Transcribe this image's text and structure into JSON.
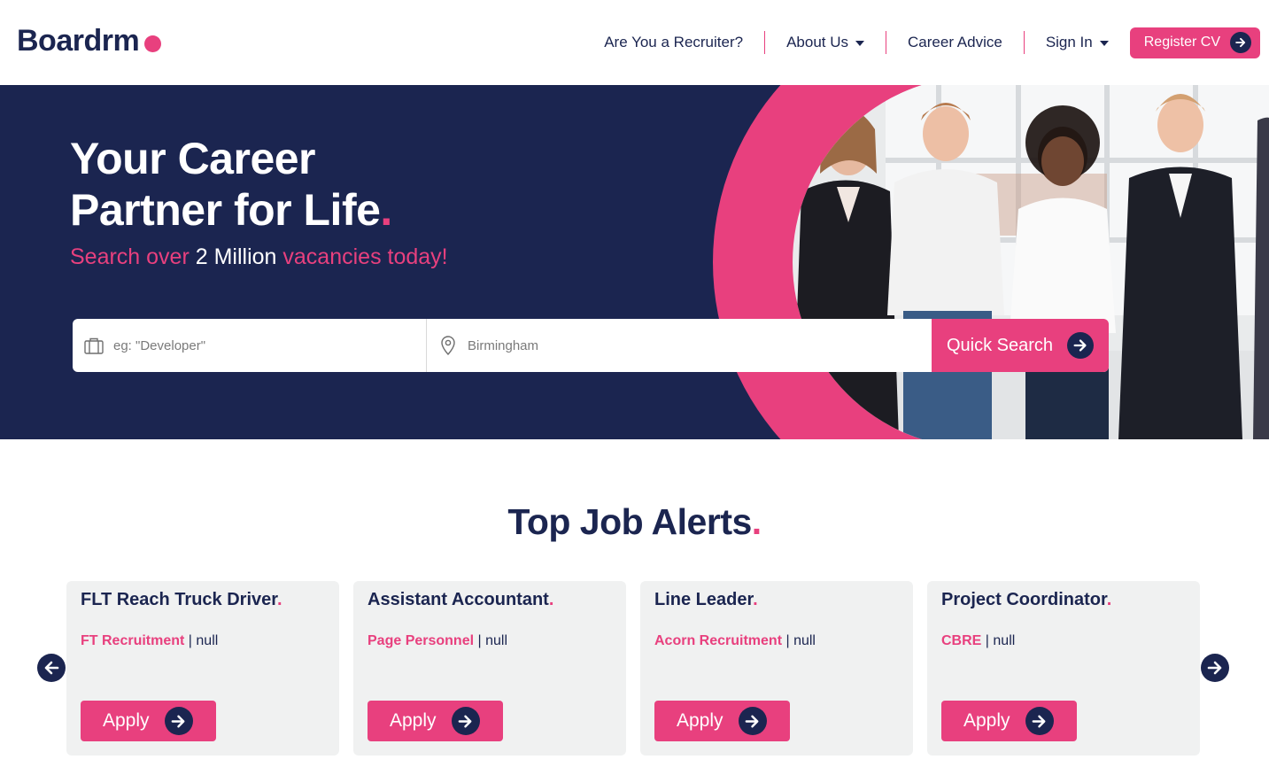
{
  "brand": {
    "name": "Boardrm",
    "pink": "#e8407e",
    "navy": "#1b2550"
  },
  "nav": {
    "items": [
      {
        "label": "Are You a Recruiter?"
      },
      {
        "label": "About Us"
      },
      {
        "label": "Career Advice"
      },
      {
        "label": "Sign In"
      }
    ],
    "register_label": "Register CV"
  },
  "hero": {
    "title_line1": "Your Career",
    "title_line2": "Partner for Life",
    "title_dot": ".",
    "sub_prefix": "Search over ",
    "sub_highlight": "2 Million",
    "sub_suffix": " vacancies today!",
    "keyword_placeholder": "eg: \"Developer\"",
    "location_value": "Birmingham",
    "search_button": "Quick Search",
    "icons": {
      "keyword": "briefcase-icon",
      "location": "map-pin-icon",
      "button": "arrow-right-icon"
    }
  },
  "jobs_section": {
    "title": "Top Job Alerts",
    "title_dot": ".",
    "apply_label": "Apply",
    "cards": [
      {
        "title": "FLT Reach Truck Driver",
        "company": "FT Recruitment",
        "location": "null"
      },
      {
        "title": "Assistant Accountant",
        "company": "Page Personnel",
        "location": "null"
      },
      {
        "title": "Line Leader",
        "company": "Acorn Recruitment",
        "location": "null"
      },
      {
        "title": "Project Coordinator",
        "company": "CBRE",
        "location": "null"
      }
    ]
  }
}
